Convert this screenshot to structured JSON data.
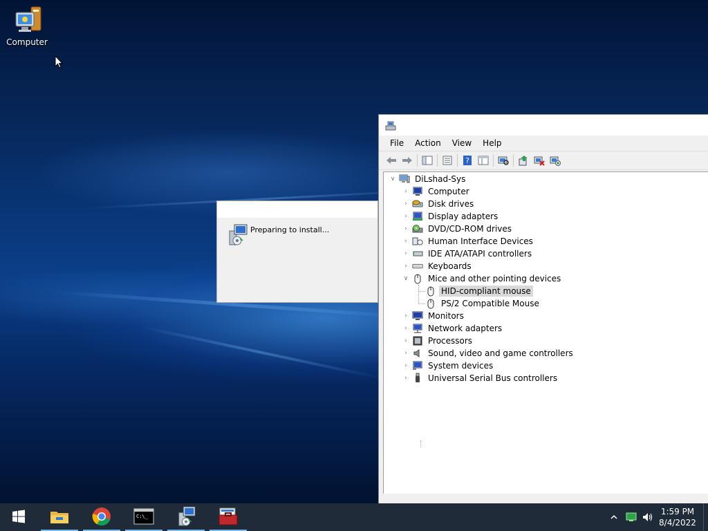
{
  "desktop": {
    "icons": [
      {
        "label": "Computer",
        "icon": "computer-icon"
      }
    ]
  },
  "installer": {
    "message": "Preparing to install...",
    "icon": "installer-icon"
  },
  "device_manager": {
    "menu": [
      "File",
      "Action",
      "View",
      "Help"
    ],
    "toolbar": [
      "back-icon",
      "forward-icon",
      "show-hide-tree-icon",
      "properties-icon",
      "help-icon",
      "view-icon",
      "scan-hardware-icon",
      "update-driver-icon",
      "uninstall-device-icon",
      "add-driver-icon"
    ],
    "tree": {
      "root": "DiLshad-Sys",
      "categories": [
        {
          "label": "Computer",
          "icon": "computer-icon",
          "expanded": false
        },
        {
          "label": "Disk drives",
          "icon": "disk-drive-icon",
          "expanded": false
        },
        {
          "label": "Display adapters",
          "icon": "display-adapter-icon",
          "expanded": false
        },
        {
          "label": "DVD/CD-ROM drives",
          "icon": "dvd-drive-icon",
          "expanded": false
        },
        {
          "label": "Human Interface Devices",
          "icon": "hid-icon",
          "expanded": false
        },
        {
          "label": "IDE ATA/ATAPI controllers",
          "icon": "ide-controller-icon",
          "expanded": false
        },
        {
          "label": "Keyboards",
          "icon": "keyboard-icon",
          "expanded": false
        },
        {
          "label": "Mice and other pointing devices",
          "icon": "mouse-icon",
          "expanded": true,
          "children": [
            {
              "label": "HID-compliant mouse",
              "icon": "mouse-icon",
              "selected": true
            },
            {
              "label": "PS/2 Compatible Mouse",
              "icon": "mouse-icon",
              "selected": false
            }
          ]
        },
        {
          "label": "Monitors",
          "icon": "monitor-icon",
          "expanded": false
        },
        {
          "label": "Network adapters",
          "icon": "network-adapter-icon",
          "expanded": false
        },
        {
          "label": "Processors",
          "icon": "processor-icon",
          "expanded": false
        },
        {
          "label": "Sound, video and game controllers",
          "icon": "sound-icon",
          "expanded": false
        },
        {
          "label": "System devices",
          "icon": "system-devices-icon",
          "expanded": false
        },
        {
          "label": "Universal Serial Bus controllers",
          "icon": "usb-icon",
          "expanded": false
        }
      ]
    }
  },
  "taskbar": {
    "apps": [
      {
        "name": "start",
        "icon": "windows-logo-icon",
        "active": false
      },
      {
        "name": "file-explorer",
        "icon": "folder-icon",
        "active": true
      },
      {
        "name": "chrome",
        "icon": "chrome-icon",
        "active": true
      },
      {
        "name": "command-prompt",
        "icon": "cmd-icon",
        "active": true
      },
      {
        "name": "installer",
        "icon": "installer-icon",
        "active": true
      },
      {
        "name": "toolbox",
        "icon": "toolbox-icon",
        "active": true
      }
    ],
    "tray_icons": [
      "show-hidden-icons-icon",
      "network-icon",
      "volume-icon"
    ],
    "clock": {
      "time": "1:59 PM",
      "date": "8/4/2022"
    }
  },
  "colors": {
    "accent": "#76b9ed",
    "taskbar": "#1f2b38",
    "selection": "#d9d9d9"
  }
}
